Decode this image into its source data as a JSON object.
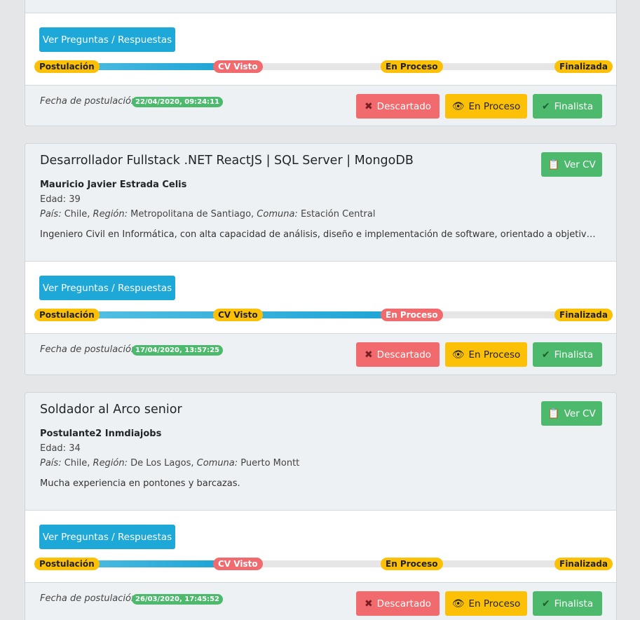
{
  "labels": {
    "ver_preguntas": "Ver Preguntas / Respuestas",
    "ver_cv": "Ver CV",
    "fecha_postulacion": "Fecha de postulación",
    "descartado": "Descartado",
    "en_proceso": "En Proceso",
    "finalista": "Finalista",
    "edad_prefix": "Edad: ",
    "pais_label": "País:",
    "region_label": "Región:",
    "comuna_label": "Comuna:"
  },
  "steps": [
    "Postulación",
    "CV Visto",
    "En Proceso",
    "Finalizada"
  ],
  "colors": {
    "info": "#1da8d8",
    "success": "#4cb96d",
    "danger": "#f06a6e",
    "warning": "#fcc107"
  },
  "icons": {
    "descartado": "x-icon",
    "en_proceso": "eye-icon",
    "finalista": "check-icon",
    "ver_cv": "clipboard-icon"
  },
  "cards": [
    {
      "progress_step": 2,
      "progress_fraction": 0.31,
      "fecha": "22/04/2020, 09:24:11"
    },
    {
      "title": "Desarrollador Fullstack .NET ReactJS | SQL Server | MongoDB",
      "name": "Mauricio Javier Estrada Celis",
      "edad": "39",
      "pais": "Chile,",
      "region": "Metropolitana de Santiago,",
      "comuna": "Estación Central",
      "desc": "Ingeniero Civil en Informática, con alta capacidad de análisis, diseño e implementación de software, orientado a objetivos y met...",
      "progress_step": 3,
      "progress_fraction": 0.61,
      "fecha": "17/04/2020, 13:57:25"
    },
    {
      "title": "Soldador al Arco senior",
      "name": "Postulante2 Inmdiajobs",
      "edad": "34",
      "pais": "Chile,",
      "region": "De Los Lagos,",
      "comuna": "Puerto Montt",
      "desc": "Mucha experiencia en pontones y barcazas.",
      "progress_step": 2,
      "progress_fraction": 0.31,
      "fecha": "26/03/2020, 17:45:52"
    }
  ]
}
